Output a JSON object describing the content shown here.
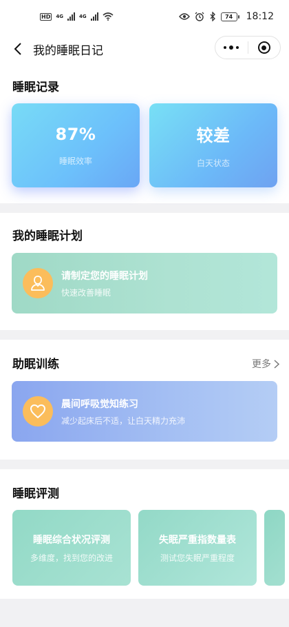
{
  "status_bar": {
    "hd": "HD",
    "net1": "4G",
    "net2": "4G",
    "battery": "74",
    "time": "18:12"
  },
  "nav": {
    "title": "我的睡眠日记"
  },
  "sleep_record": {
    "title": "睡眠记录",
    "cards": [
      {
        "value": "87%",
        "label": "睡眠效率"
      },
      {
        "value": "较差",
        "label": "白天状态"
      }
    ]
  },
  "sleep_plan": {
    "title": "我的睡眠计划",
    "card_title": "请制定您的睡眠计划",
    "card_sub": "快速改善睡眠",
    "icon": "user-icon"
  },
  "training": {
    "title": "助眠训练",
    "more_label": "更多",
    "card_title": "晨间呼吸觉知练习",
    "card_sub": "减少起床后不适，让白天精力充沛",
    "icon": "heart-icon"
  },
  "assessment": {
    "title": "睡眠评测",
    "cards": [
      {
        "title": "睡眠综合状况评测",
        "sub": "多维度，找到您的改进"
      },
      {
        "title": "失眠严重指数量表",
        "sub": "测试您失眠严重程度"
      }
    ]
  },
  "colors": {
    "icon_orange": "#fbbd5b",
    "plan_green": "#a8dfcf",
    "train_blue": "#9ab5f2",
    "record_blue": "#6cc0fb"
  }
}
